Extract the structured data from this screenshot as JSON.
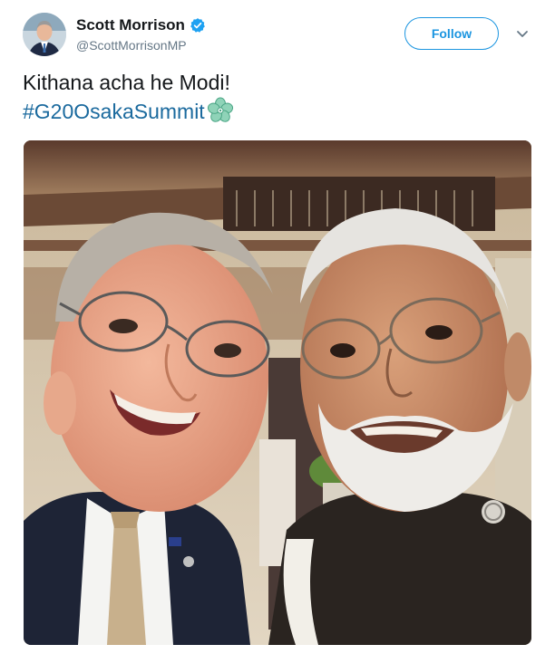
{
  "author": {
    "display_name": "Scott Morrison",
    "handle": "@ScottMorrisonMP",
    "verified": true
  },
  "actions": {
    "follow_label": "Follow",
    "more_icon": "chevron-down-icon"
  },
  "tweet": {
    "text": "Kithana acha he Modi!",
    "hashtag": "#G20OsakaSummit",
    "emoji_icon": "cherry-blossom-emoji"
  },
  "colors": {
    "accent": "#1b95e0",
    "hashtag": "#1b6a9e",
    "secondary_text": "#657786",
    "primary_text": "#14171a"
  }
}
